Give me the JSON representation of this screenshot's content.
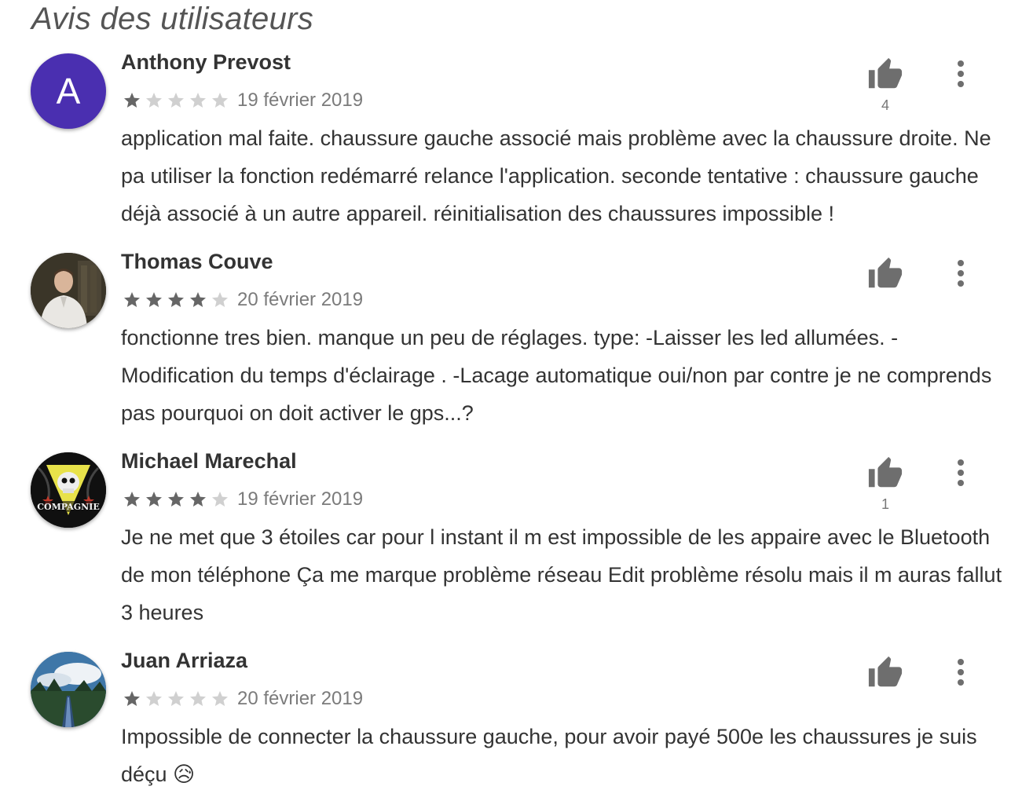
{
  "title": "Avis des utilisateurs",
  "colors": {
    "avatar_a": "#4a2fb0",
    "star_filled": "#666666",
    "star_empty": "#d0d0d0",
    "thumb": "#6e6e6e"
  },
  "reviews": [
    {
      "author": "Anthony Prevost",
      "avatar_letter": "A",
      "rating": 1,
      "date": "19 février 2019",
      "text": "application mal faite. chaussure gauche associé mais problème avec la chaussure droite. Ne pa utiliser la fonction redémarré relance l'application. seconde tentative : chaussure gauche déjà associé à un autre appareil. réinitialisation des chaussures impossible !",
      "likes": "4"
    },
    {
      "author": "Thomas Couve",
      "avatar_letter": "",
      "rating": 4,
      "date": "20 février 2019",
      "text": "fonctionne tres bien. manque un peu de réglages. type: -Laisser les led allumées. -Modification du temps d'éclairage . -Lacage automatique oui/non par contre je ne comprends pas pourquoi on doit activer le gps...?",
      "likes": ""
    },
    {
      "author": "Michael Marechal",
      "avatar_letter": "",
      "avatar_text": "COMPAGNIE",
      "rating": 4,
      "date": "19 février 2019",
      "text": "Je ne met que 3 étoiles car pour l instant il m est impossible de les appaire avec le Bluetooth de mon téléphone Ça me marque problème réseau Edit problème résolu mais il m auras fallut 3 heures",
      "likes": "1"
    },
    {
      "author": "Juan Arriaza",
      "avatar_letter": "",
      "rating": 1,
      "date": "20 février 2019",
      "text": "Impossible de connecter la chaussure gauche, pour avoir payé 500e les chaussures je suis déçu 😥",
      "likes": ""
    }
  ]
}
